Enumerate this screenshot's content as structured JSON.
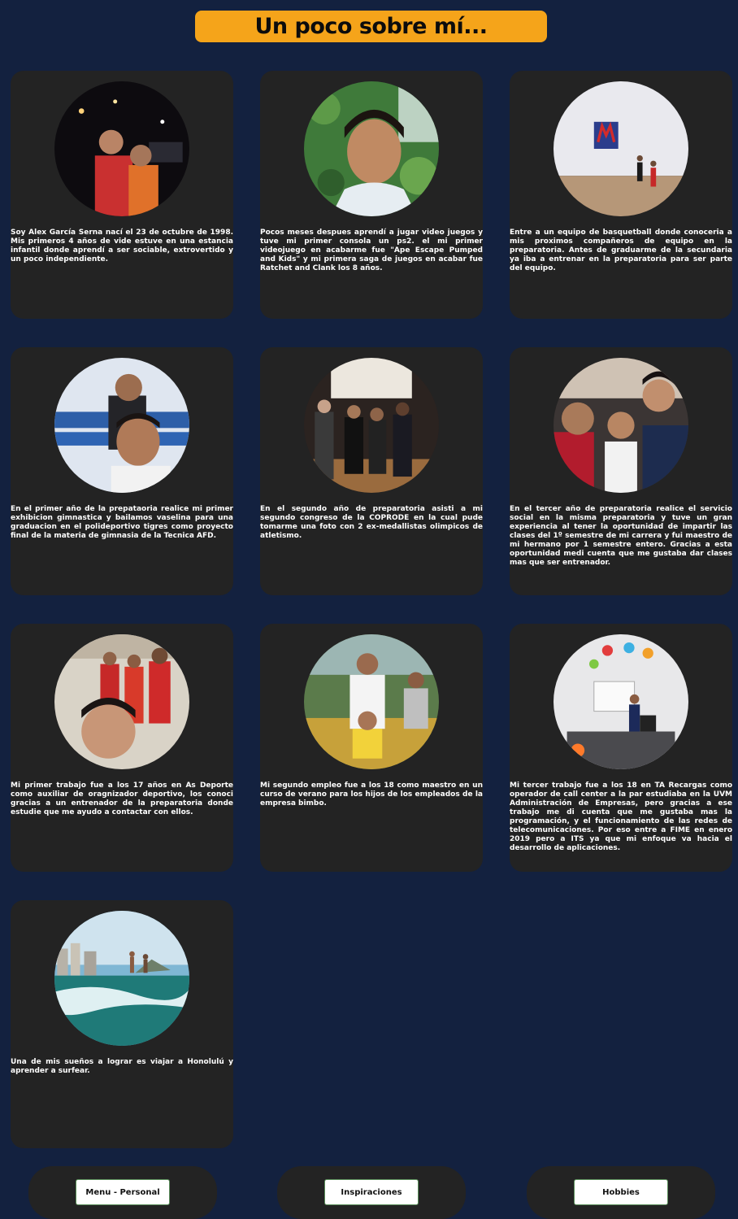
{
  "header": {
    "title": "Un poco sobre mí..."
  },
  "cards": [
    {
      "text": "Soy Alex García Serna nací el 23 de octubre de 1998. Mis primeros 4 años de vide estuve en una estancia infantil donde aprendí a ser sociable, extrovertido y un poco independiente.",
      "photo": "childhood-photo"
    },
    {
      "text": "Pocos meses despues aprendí a jugar video juegos y tuve mi primer consola un ps2. el mi primer videojuego en acabarme fue \"Ape Escape Pumped and Kids\" y mi primera saga de juegos en acabar fue Ratchet and Clank los 8 años.",
      "photo": "boy-portrait-photo"
    },
    {
      "text": "Entre a un equipo de basquetball donde conoceria a mis proximos compañeros de equipo en la preparatoria. Antes de graduarme de la secundaria ya iba a entrenar en la preparatoria para ser parte del equipo.",
      "photo": "basketball-court-photo"
    },
    {
      "text": "En el primer año de la prepataoria realice mi primer exhibicion gimnastica y bailamos vaselina para una graduacion en el polideportivo tigres como proyecto final de la materia de gimnasia de la Tecnica AFD.",
      "photo": "stadium-selfie-photo"
    },
    {
      "text": "En el segundo año de preparatoria asisti a mi segundo congreso de la COPRODE en la cual pude tomarme una foto con 2 ex-medallistas olimpicos de atletismo.",
      "photo": "congress-group-photo"
    },
    {
      "text": "En el tercer año de preparatoria realice el servicio social en la misma preparatoria y tuve un gran experiencia al tener la oportunidad de impartir las clases del 1º semestre de mi carrera y fui maestro de mi hermano por 1 semestre entero. Gracias a esta oportunidad medi cuenta que me gustaba dar clases mas que ser entrenador.",
      "photo": "family-selfie-photo"
    },
    {
      "text": "Mi primer trabajo fue a los 17 años en As Deporte como auxiliar de oragnizador deportivo, los conoci gracias a un entrenador de la preparatoria donde estudie que me ayudo a contactar con ellos.",
      "photo": "sports-event-photo"
    },
    {
      "text": "Mi segundo empleo fue a los 18 como maestro en un curso de verano para los hijos de los empleados de la empresa bimbo.",
      "photo": "summer-course-photo"
    },
    {
      "text": "Mi tercer trabajo fue a los 18 en TA Recargas como operador de call center a la par estudiaba en la UVM Administración de Empresas, pero gracias a ese trabajo me di cuenta que me gustaba mas la programación, y el funcionamiento de las redes de telecomunicaciones. Por eso entre a FIME en enero 2019 pero a ITS ya que mi enfoque va hacia el desarrollo de aplicaciones.",
      "photo": "office-photo"
    },
    {
      "text": "Una de mis sueños a lograr es viajar a Honolulú y aprender a surfear.",
      "photo": "surfing-photo"
    }
  ],
  "nav": {
    "menu_personal": "Menu - Personal",
    "inspiraciones": "Inspiraciones",
    "hobbies": "Hobbies"
  },
  "colors": {
    "background": "#13213f",
    "card": "#232323",
    "title_bg": "#f5a41a"
  }
}
